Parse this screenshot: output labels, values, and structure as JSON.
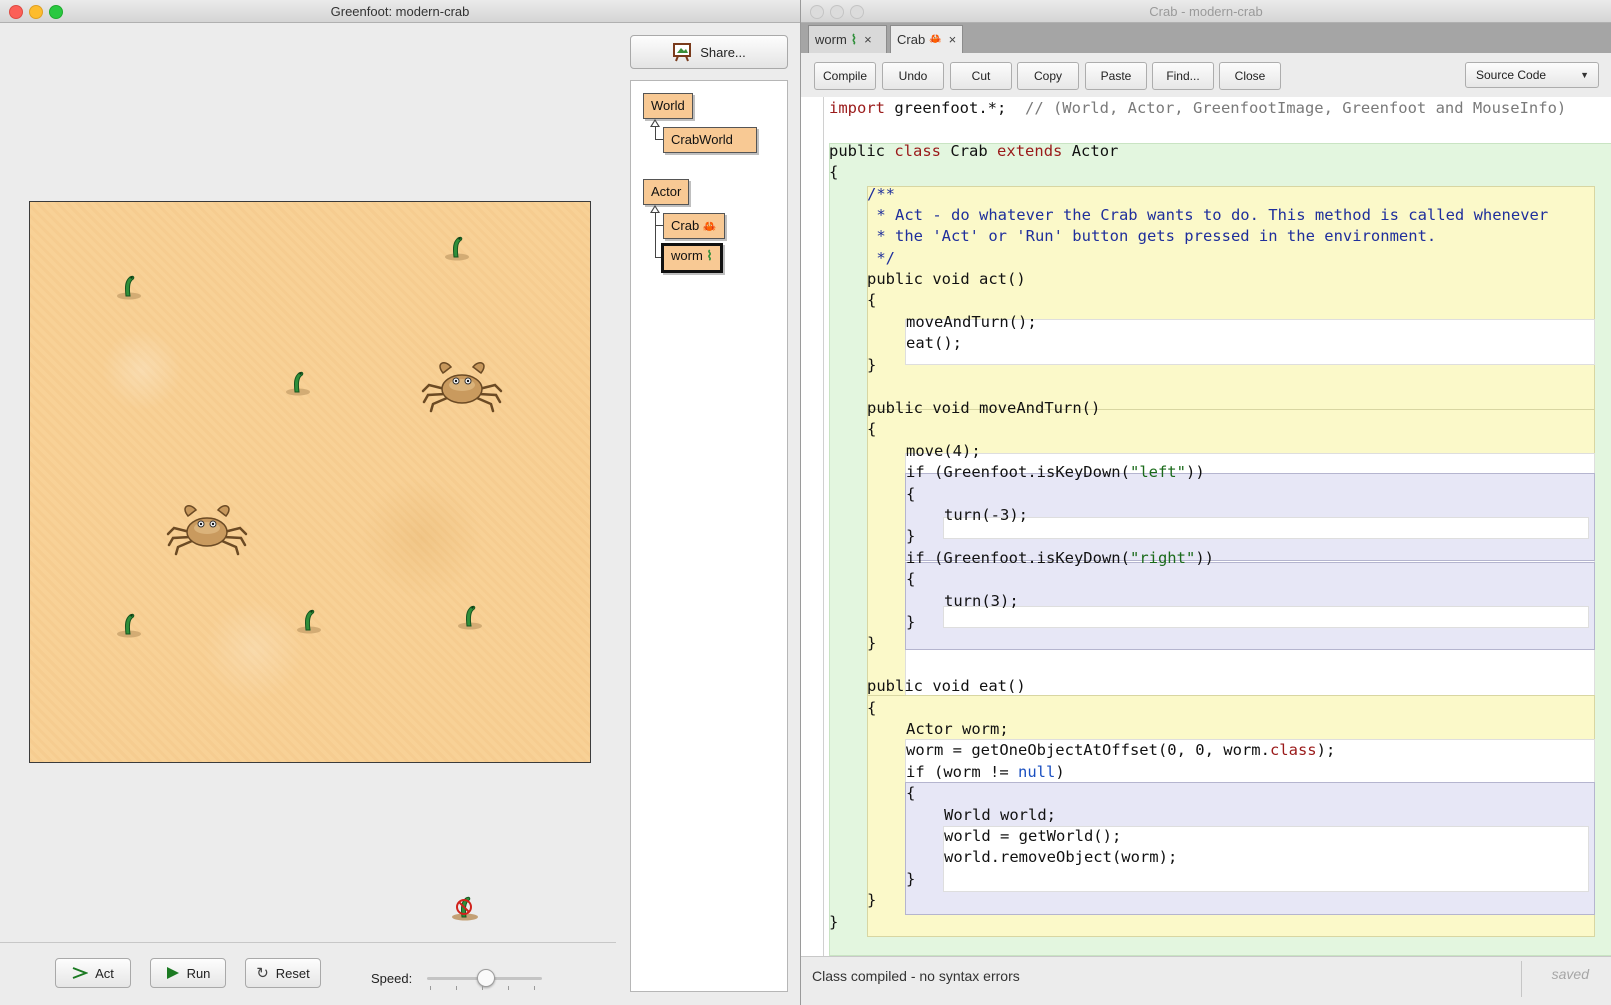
{
  "greenfoot_window": {
    "title": "Greenfoot: modern-crab",
    "share_label": "Share...",
    "classes": {
      "world": "World",
      "crab_world": "CrabWorld",
      "actor": "Actor",
      "crab": "Crab",
      "worm": "worm"
    },
    "controls": {
      "act_label": "Act",
      "run_label": "Run",
      "reset_label": "Reset",
      "speed_label": "Speed:",
      "speed_value": 0.5
    },
    "actors": {
      "worm_count": 6,
      "crab_count": 2
    }
  },
  "editor_window": {
    "title": "Crab - modern-crab",
    "tabs": [
      {
        "label": "worm",
        "close": "×"
      },
      {
        "label": "Crab",
        "close": "×"
      }
    ],
    "toolbar": {
      "compile": "Compile",
      "undo": "Undo",
      "cut": "Cut",
      "copy": "Copy",
      "paste": "Paste",
      "find": "Find...",
      "close": "Close",
      "view_select": "Source Code"
    },
    "code": {
      "l1_import": "import",
      "l1_rest": " greenfoot.*;  ",
      "l1_comment": "// (World, Actor, GreenfootImage, Greenfoot and MouseInfo)",
      "class_public": "public",
      "class_kw": "class",
      "class_name": "Crab",
      "extends_kw": "extends",
      "super_name": "Actor",
      "open_brace": "{",
      "close_brace": "}",
      "doc_open": "/**",
      "doc_line1": " * Act - do whatever the Crab wants to do. This method is called whenever",
      "doc_line2": " * the 'Act' or 'Run' button gets pressed in the environment.",
      "doc_close": " */",
      "public_void": "public void",
      "act_sig": "act()",
      "act_body1": "moveAndTurn();",
      "act_body2": "eat();",
      "mat_sig": "moveAndTurn()",
      "move4": "move(4);",
      "if_kw": "if",
      "if_left_pre": " (Greenfoot.isKeyDown(",
      "left_str": "\"left\"",
      "if_post": "))",
      "turn_neg3": "turn(-3);",
      "right_str": "\"right\"",
      "turn_3": "turn(3);",
      "eat_sig": "eat()",
      "actor_worm": "Actor worm;",
      "worm_assign_pre": "worm = getOneObjectAtOffset(0, 0, worm.",
      "class_word": "class",
      "worm_assign_post": ");",
      "if_worm_pre": " (worm != ",
      "null_kw": "null",
      "if_worm_post": ")",
      "world_decl": "World world;",
      "world_assign": "world = getWorld();",
      "remove_obj": "world.removeObject(worm);"
    },
    "status": "Class compiled - no syntax errors",
    "saved": "saved"
  }
}
